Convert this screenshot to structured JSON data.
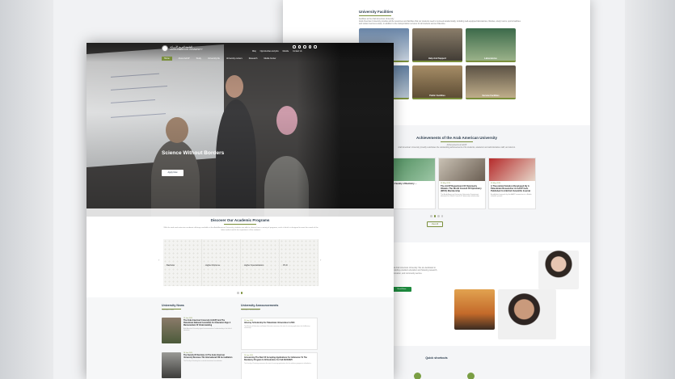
{
  "colors": {
    "accent": "#7a8f3b",
    "green_button": "#1e8a3e",
    "navy": "#2a3b4c"
  },
  "back_page": {
    "facilities": {
      "title": "University Facilities",
      "subtitle": "Facilities at the Arab American University",
      "para": "Arab American University provides all the resources and facilities that our students need to succeed academically, including well-equipped laboratories, libraries, study rooms, sports facilities and student services areas, in addition to the transportation services for all students across Palestine.",
      "cards": [
        "",
        "Help And Support",
        "Laboratories",
        "",
        "Public Facilities",
        "Service Facilities"
      ]
    },
    "achievements": {
      "title": "Achievements of the Arab American University",
      "subtitle": "Achievements at AAUP",
      "para": "Arab American University proudly celebrates the outstanding achievements of its students, academic and administrative staff, and alumni.",
      "cards": [
        {
          "date": "",
          "title": "The Faculty of Dentistry ...",
          "desc": ""
        },
        {
          "date": "18 May 2024",
          "title": "The AAUP Department Of Optometry Obtains The World Council Of Optometry (WCO) Membership",
          "desc": "The Arab American University Optometry Department obtained the World Council of Optometry membership."
        },
        {
          "date": "18 May 2024",
          "title": "A Theoretical Solution Developed By A Palestinian Researcher At AAUP Gets Published In A British Scientific Journal",
          "desc": "A published research by the AAUP researcher in a British scientific journal."
        }
      ],
      "view_all": "View All"
    },
    "president": {
      "para": "...at Arab American University. We are dedicated to providing excellent education and fostering research, innovation, and community service.",
      "button": "Read More"
    },
    "quick": {
      "title": "Quick shortcuts",
      "subtitle": "Useful links for students and staff"
    }
  },
  "front_page": {
    "logo_text_ar": "الجامعة العربية الأمريكية",
    "logo_text_en": "ARAB AMERICAN UNIVERSITY",
    "utils": [
      "Ritaj",
      "Opportunities and jobs",
      "Moodle",
      "Contact Us"
    ],
    "nav": [
      "Home",
      "About AAUP",
      "Study",
      "University life",
      "University centers",
      "Research",
      "Media Center"
    ],
    "hero": {
      "title": "Science Without Borders",
      "button": "Apply Now"
    },
    "programs": {
      "title": "Discover Our Academic Programs",
      "subtitle": "Academic programs at the Arab American University",
      "para": "With the wide and extensive academic offerings available at the Arab American University, students are able to choose from a variety of programs, each of which is designed to meet the needs of the labor market and fit the aspirations of the students.",
      "items": [
        "Bachelor",
        "Higher Diploma",
        "Higher Specialization",
        "Ph.D"
      ]
    },
    "news": {
      "title": "University News",
      "subtitle": "Latest AAUP news",
      "items": [
        {
          "date": "29 June 2024",
          "title": "The Arab American University (AAUP) And The Palestinian National Committee For Education Sign A Memorandum Of Understanding",
          "desc": "Arab American University signed a memorandum of understanding in the field of education."
        },
        {
          "date": "26 June 2024",
          "title": "The Faculty Of Dentistry At The Arab American University Receives The International FDI Accreditation",
          "desc": "The Faculty of Dentistry has received international accreditation."
        }
      ]
    },
    "announcements": {
      "title": "University Announcements",
      "subtitle": "Latest AAUP announcements",
      "items": [
        {
          "date": "29 June 2024",
          "title": "Attorney Scholarship For Palestinian Universities In 2024",
          "desc": "The Ministry of Education and Higher Education announces the start of receiving applications for the Attorney scholarship."
        },
        {
          "date": "28 June 2024",
          "title": "Announcing The Start Of Accepting Applications For Admission To The Residency Program In Orthodontics For Fall 2024/2025",
          "desc": "The Faculty of Dentistry announces the start of receiving applications for the residency program in orthodontics."
        }
      ]
    }
  }
}
